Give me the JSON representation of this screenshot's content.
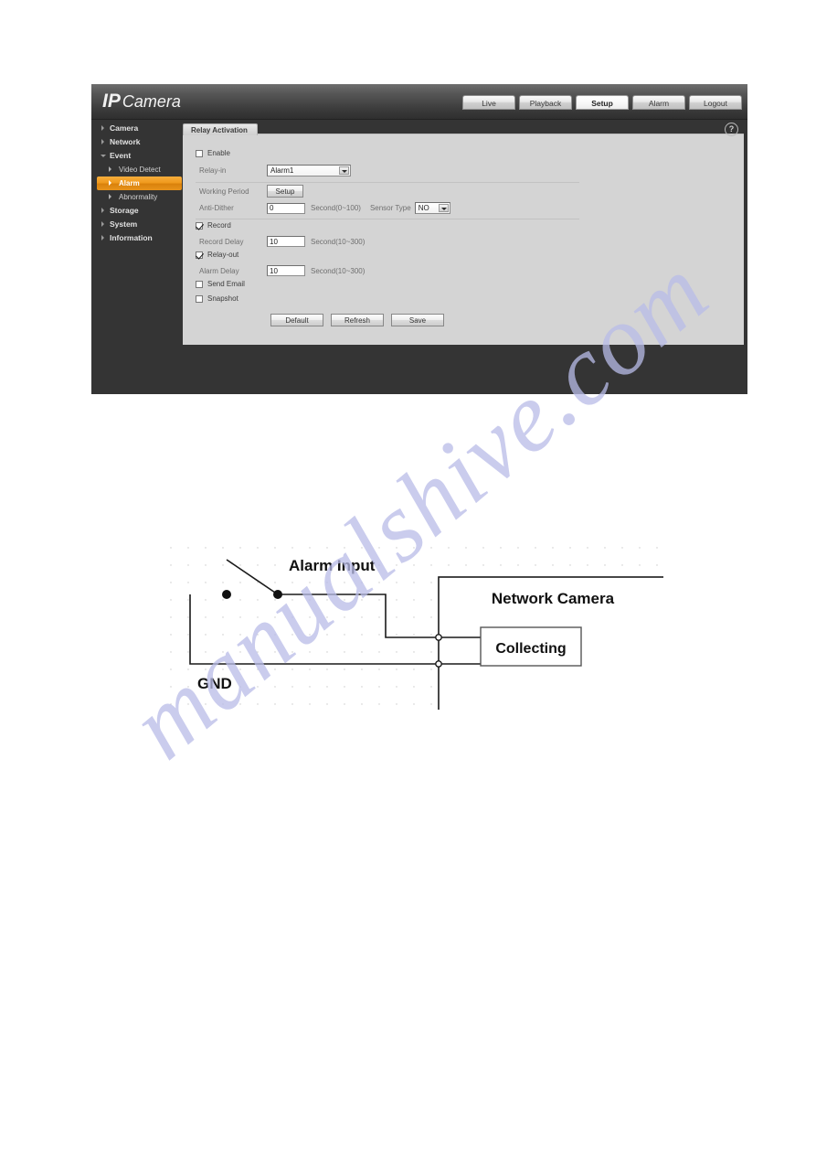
{
  "watermark": {
    "text": "manualshive.com"
  },
  "app": {
    "brand_ip": "IP",
    "brand_camera": "Camera",
    "help_icon_label": "?"
  },
  "top_nav": {
    "tabs": [
      {
        "label": "Live",
        "active": false
      },
      {
        "label": "Playback",
        "active": false
      },
      {
        "label": "Setup",
        "active": true
      },
      {
        "label": "Alarm",
        "active": false
      },
      {
        "label": "Logout",
        "active": false
      }
    ]
  },
  "sidebar": {
    "items": [
      {
        "label": "Camera",
        "type": "group",
        "expanded": false
      },
      {
        "label": "Network",
        "type": "group",
        "expanded": false
      },
      {
        "label": "Event",
        "type": "group",
        "expanded": true
      },
      {
        "label": "Video Detect",
        "type": "sub",
        "selected": false
      },
      {
        "label": "Alarm",
        "type": "sub",
        "selected": true
      },
      {
        "label": "Abnormality",
        "type": "sub",
        "selected": false
      },
      {
        "label": "Storage",
        "type": "group",
        "expanded": false
      },
      {
        "label": "System",
        "type": "group",
        "expanded": false
      },
      {
        "label": "Information",
        "type": "group",
        "expanded": false
      }
    ]
  },
  "panel": {
    "tab_label": "Relay Activation"
  },
  "form": {
    "enable": {
      "label": "Enable",
      "checked": false
    },
    "relay_in": {
      "label": "Relay-in",
      "value": "Alarm1"
    },
    "working_period": {
      "label": "Working Period",
      "button": "Setup"
    },
    "anti_dither": {
      "label": "Anti-Dither",
      "value": "0",
      "unit": "Second(0~100)"
    },
    "sensor_type": {
      "label": "Sensor Type",
      "value": "NO"
    },
    "record": {
      "label": "Record",
      "checked": true
    },
    "record_delay": {
      "label": "Record Delay",
      "value": "10",
      "unit": "Second(10~300)"
    },
    "relay_out": {
      "label": "Relay-out",
      "checked": true
    },
    "alarm_delay": {
      "label": "Alarm Delay",
      "value": "10",
      "unit": "Second(10~300)"
    },
    "send_email": {
      "label": "Send Email",
      "checked": false
    },
    "snapshot": {
      "label": "Snapshot",
      "checked": false
    },
    "buttons": {
      "default": "Default",
      "refresh": "Refresh",
      "save": "Save"
    }
  },
  "diagram": {
    "alarm_input_label": "Alarm Input",
    "gnd_label": "GND",
    "network_camera_label": "Network Camera",
    "collecting_label": "Collecting"
  }
}
